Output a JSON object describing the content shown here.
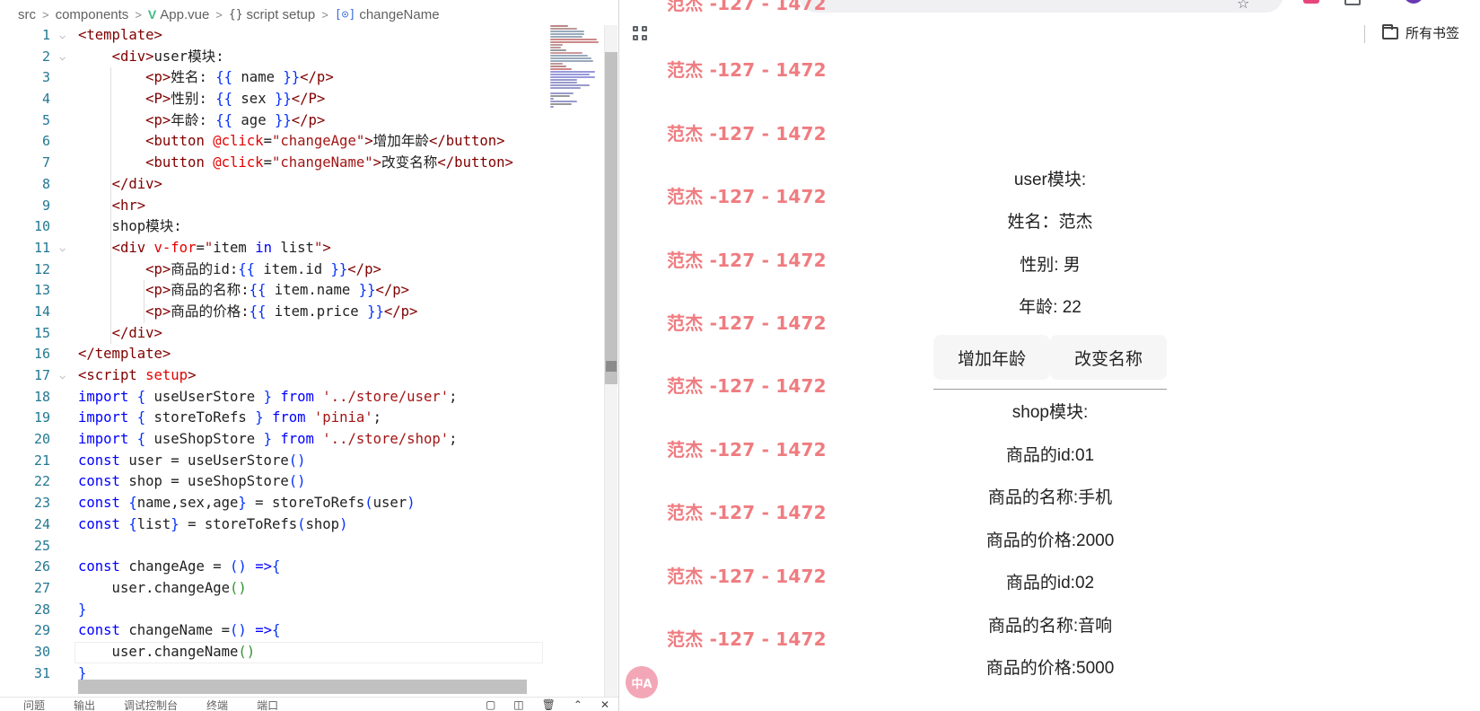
{
  "breadcrumb": {
    "items": [
      "src",
      "components",
      "App.vue",
      "script setup",
      "changeName"
    ],
    "separator": ">",
    "vue_icon_glyph": "V",
    "braces_icon_glyph": "{}",
    "method_icon_glyph": "[⊙]"
  },
  "editor": {
    "current_line": 30,
    "lines": [
      {
        "n": 1,
        "fold": true,
        "html": "<span class=\"tag\">&lt;template&gt;</span>"
      },
      {
        "n": 2,
        "fold": true,
        "html": "    <span class=\"tag\">&lt;div&gt;</span>user模块:"
      },
      {
        "n": 3,
        "html": "        <span class=\"tag\">&lt;p&gt;</span>姓名: <span class=\"brace\">{{</span> name <span class=\"brace\">}}</span><span class=\"tag\">&lt;/p&gt;</span>"
      },
      {
        "n": 4,
        "html": "        <span class=\"tag\">&lt;P&gt;</span>性别: <span class=\"brace\">{{</span> sex <span class=\"brace\">}}</span><span class=\"tag\">&lt;/P&gt;</span>"
      },
      {
        "n": 5,
        "html": "        <span class=\"tag\">&lt;p&gt;</span>年龄: <span class=\"brace\">{{</span> age <span class=\"brace\">}}</span><span class=\"tag\">&lt;/p&gt;</span>"
      },
      {
        "n": 6,
        "html": "        <span class=\"tag\">&lt;button</span> <span class=\"attr\">@click</span>=<span class=\"str\">\"changeAge\"</span><span class=\"tag\">&gt;</span>增加年龄<span class=\"tag\">&lt;/button&gt;</span>"
      },
      {
        "n": 7,
        "html": "        <span class=\"tag\">&lt;button</span> <span class=\"attr\">@click</span>=<span class=\"str\">\"changeName\"</span><span class=\"tag\">&gt;</span>改变名称<span class=\"tag\">&lt;/button&gt;</span>"
      },
      {
        "n": 8,
        "html": "    <span class=\"tag\">&lt;/div&gt;</span>"
      },
      {
        "n": 9,
        "html": "    <span class=\"tag\">&lt;hr&gt;</span>"
      },
      {
        "n": 10,
        "html": "    shop模块:"
      },
      {
        "n": 11,
        "fold": true,
        "html": "    <span class=\"tag\">&lt;div</span> <span class=\"attr\">v-for</span>=<span class=\"str\">\"</span><span class=\"txt\">item</span> <span class=\"kw\">in</span> <span class=\"txt\">list</span><span class=\"str\">\"</span><span class=\"tag\">&gt;</span>"
      },
      {
        "n": 12,
        "html": "        <span class=\"tag\">&lt;p&gt;</span>商品的id:<span class=\"brace\">{{</span> item.id <span class=\"brace\">}}</span><span class=\"tag\">&lt;/p&gt;</span>"
      },
      {
        "n": 13,
        "html": "        <span class=\"tag\">&lt;p&gt;</span>商品的名称:<span class=\"brace\">{{</span> item.name <span class=\"brace\">}}</span><span class=\"tag\">&lt;/p&gt;</span>"
      },
      {
        "n": 14,
        "html": "        <span class=\"tag\">&lt;p&gt;</span>商品的价格:<span class=\"brace\">{{</span> item.price <span class=\"brace\">}}</span><span class=\"tag\">&lt;/p&gt;</span>"
      },
      {
        "n": 15,
        "html": "    <span class=\"tag\">&lt;/div&gt;</span>"
      },
      {
        "n": 16,
        "html": "<span class=\"tag\">&lt;/template&gt;</span>"
      },
      {
        "n": 17,
        "fold": true,
        "html": "<span class=\"tag\">&lt;script</span> <span class=\"attr\">setup</span><span class=\"tag\">&gt;</span>"
      },
      {
        "n": 18,
        "html": "<span class=\"kw\">import</span> <span class=\"brace\">{</span> useUserStore <span class=\"brace\">}</span> <span class=\"kw\">from</span> <span class=\"str\">'../store/user'</span>;"
      },
      {
        "n": 19,
        "html": "<span class=\"kw\">import</span> <span class=\"brace\">{</span> storeToRefs <span class=\"brace\">}</span> <span class=\"kw\">from</span> <span class=\"str\">'pinia'</span>;"
      },
      {
        "n": 20,
        "html": "<span class=\"kw\">import</span> <span class=\"brace\">{</span> useShopStore <span class=\"brace\">}</span> <span class=\"kw\">from</span> <span class=\"str\">'../store/shop'</span>;"
      },
      {
        "n": 21,
        "html": "<span class=\"kw\">const</span> user = useUserStore<span class=\"brace\">()</span>"
      },
      {
        "n": 22,
        "html": "<span class=\"kw\">const</span> shop = useShopStore<span class=\"brace\">()</span>"
      },
      {
        "n": 23,
        "html": "<span class=\"kw\">const</span> <span class=\"brace\">{</span>name,sex,age<span class=\"brace\">}</span> = storeToRefs<span class=\"brace\">(</span>user<span class=\"brace\">)</span>"
      },
      {
        "n": 24,
        "html": "<span class=\"kw\">const</span> <span class=\"brace\">{</span>list<span class=\"brace\">}</span> = storeToRefs<span class=\"brace\">(</span>shop<span class=\"brace\">)</span>"
      },
      {
        "n": 25,
        "html": ""
      },
      {
        "n": 26,
        "html": "<span class=\"kw\">const</span> changeAge = <span class=\"brace\">()</span> <span class=\"kw\">=&gt;</span><span class=\"brace\">{</span>"
      },
      {
        "n": 27,
        "html": "    user.changeAge<span class=\"paren\">()</span>"
      },
      {
        "n": 28,
        "html": "<span class=\"brace\">}</span>"
      },
      {
        "n": 29,
        "html": "<span class=\"kw\">const</span> changeName =<span class=\"brace\">()</span> <span class=\"kw\">=&gt;</span><span class=\"brace\">{</span>"
      },
      {
        "n": 30,
        "html": "    user.changeName<span class=\"paren\">()</span>"
      },
      {
        "n": 31,
        "html": "<span class=\"brace\">}</span>"
      }
    ]
  },
  "panel_tabs": [
    "问题",
    "输出",
    "调试控制台",
    "终端",
    "端口"
  ],
  "browser": {
    "bookmarks_label": "所有书签",
    "watermark_text": "范杰 -127 - 1472",
    "translate_badge": "中A",
    "app": {
      "user_title": "user模块:",
      "name_line": "姓名：范杰",
      "sex_line": "性别: 男",
      "age_line": "年龄: 22",
      "btn_change_age": "增加年龄",
      "btn_change_name": "改变名称",
      "shop_title": "shop模块:",
      "items": [
        {
          "id": "商品的id:01",
          "name": "商品的名称:手机",
          "price": "商品的价格:2000"
        },
        {
          "id": "商品的id:02",
          "name": "商品的名称:音响",
          "price": "商品的价格:5000"
        }
      ]
    }
  },
  "colors": {
    "watermark": "#ef7c80",
    "line_number": "#237893",
    "tag": "#800000",
    "attribute": "#e50000",
    "string": "#a31515",
    "keyword": "#0000ff"
  }
}
